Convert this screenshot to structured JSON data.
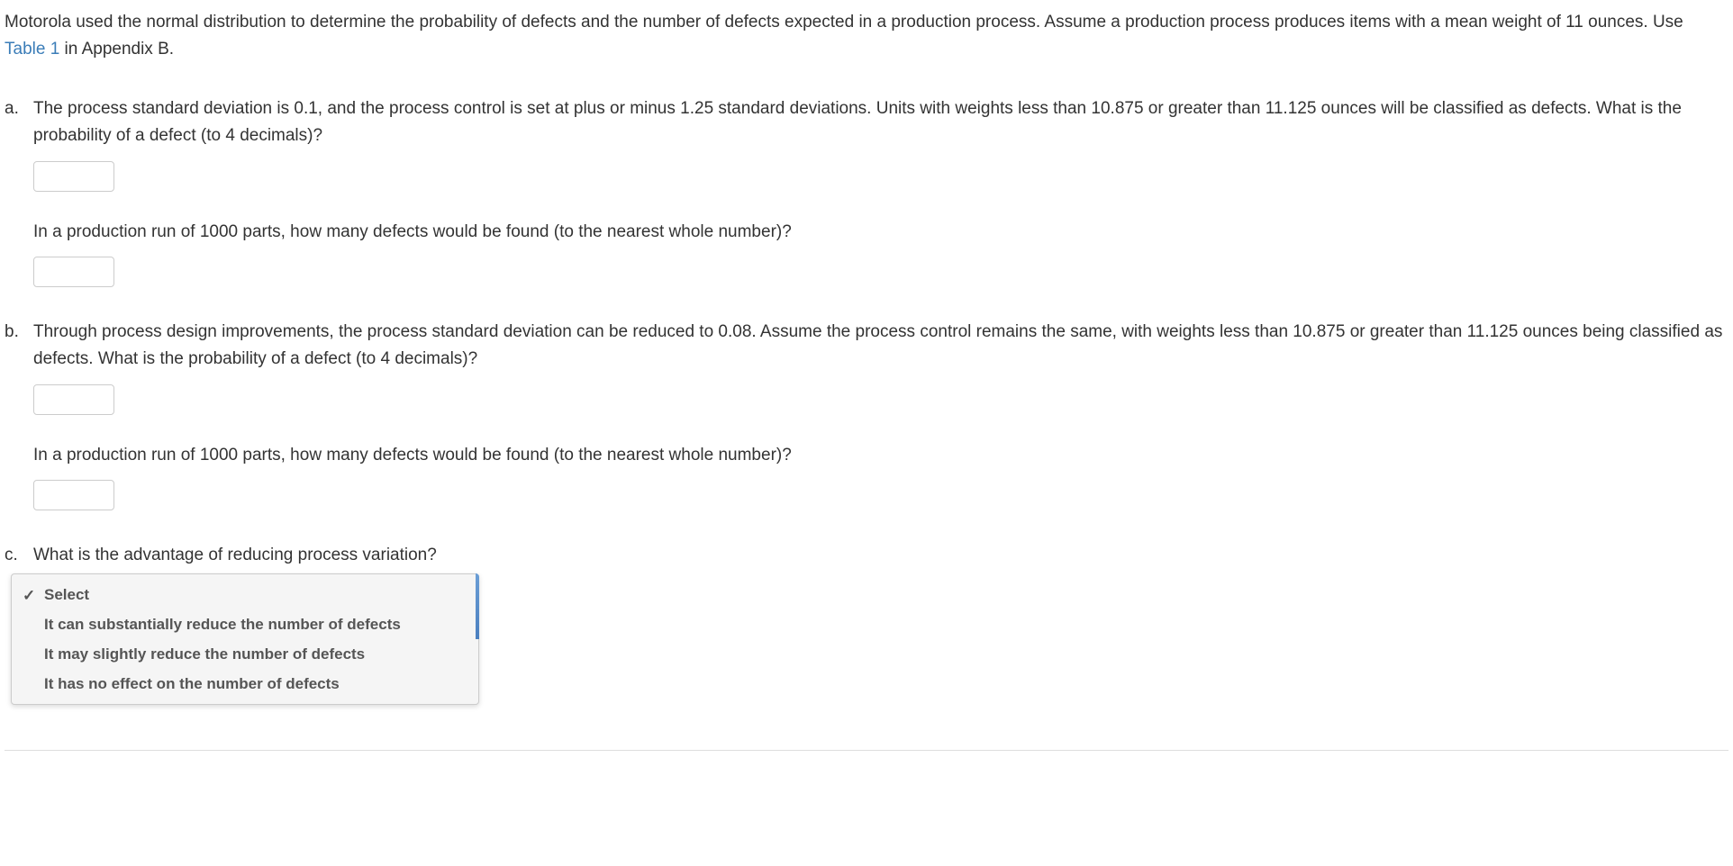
{
  "intro": {
    "text_before_link": "Motorola used the normal distribution to determine the probability of defects and the number of defects expected in a production process. Assume a production process produces items with a mean weight of 11 ounces. Use ",
    "link_text": "Table 1",
    "text_after_link": " in Appendix B."
  },
  "questions": {
    "a": {
      "marker": "a.",
      "text1": "The process standard deviation is 0.1, and the process control is set at plus or minus 1.25 standard deviations. Units with weights less than 10.875 or greater than 11.125 ounces will be classified as defects. What is the probability of a defect (to 4 decimals)?",
      "input1": "",
      "text2": "In a production run of 1000 parts, how many defects would be found (to the nearest whole number)?",
      "input2": ""
    },
    "b": {
      "marker": "b.",
      "text1": "Through process design improvements, the process standard deviation can be reduced to 0.08. Assume the process control remains the same, with weights less than 10.875 or greater than 11.125 ounces being classified as defects. What is the probability of a defect (to 4 decimals)?",
      "input1": "",
      "text2": "In a production run of 1000 parts, how many defects would be found (to the nearest whole number)?",
      "input2": ""
    },
    "c": {
      "marker": "c.",
      "text": "What is the advantage of reducing process variation?",
      "dropdown": {
        "selected": "Select",
        "options": [
          "Select",
          "It can substantially reduce the number of defects",
          "It may slightly reduce the number of defects",
          "It has no effect on the number of defects"
        ]
      }
    }
  },
  "icons": {
    "check": "✓"
  }
}
